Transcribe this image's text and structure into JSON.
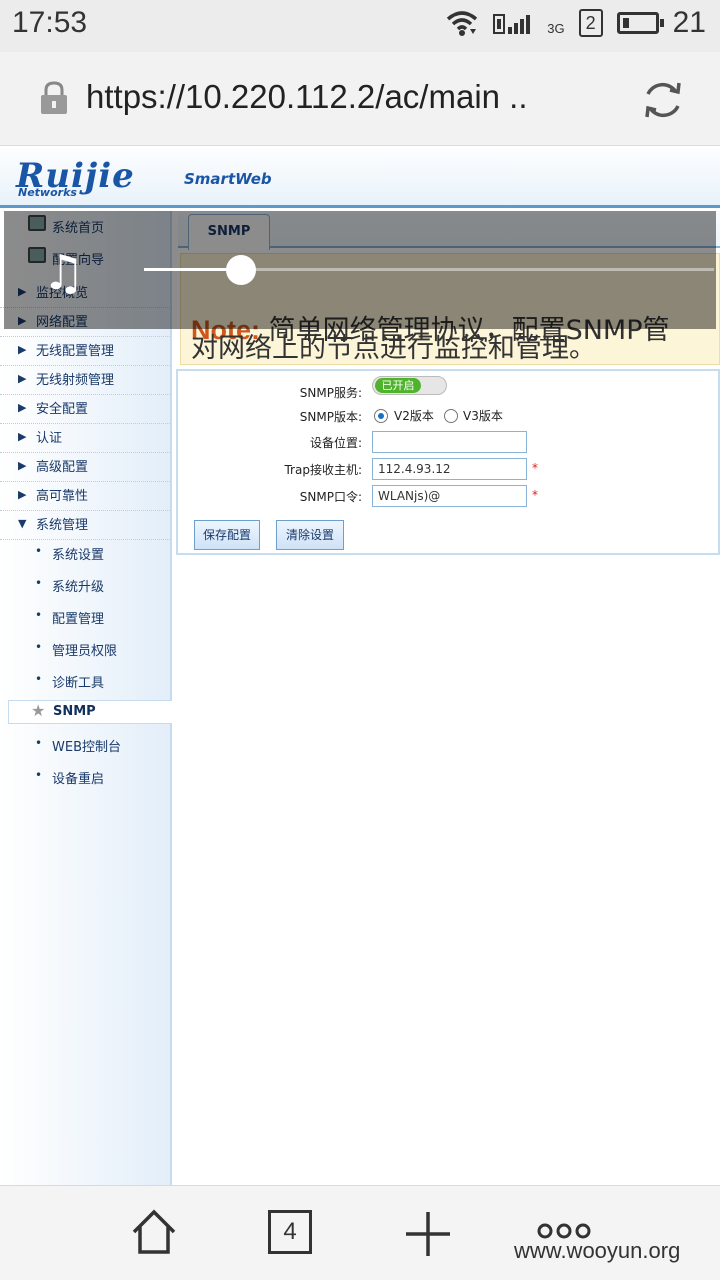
{
  "status_bar": {
    "time": "17:53",
    "network": "3G",
    "sim_slot": "2",
    "battery_percent": "21",
    "battery_level": 0.21
  },
  "browser": {
    "url": "https://10.220.112.2/ac/main ..",
    "tabs_count": "4",
    "watermark": "www.wooyun.org"
  },
  "header": {
    "logo": "Ruijie",
    "logo_sub": "Networks",
    "product": "SmartWeb"
  },
  "sidebar": {
    "top_items": [
      {
        "label": "系统首页"
      },
      {
        "label": "配置向导"
      }
    ],
    "groups": [
      {
        "label": "监控概览"
      },
      {
        "label": "网络配置"
      },
      {
        "label": "无线配置管理"
      },
      {
        "label": "无线射频管理"
      },
      {
        "label": "安全配置"
      },
      {
        "label": "认证"
      },
      {
        "label": "高级配置"
      },
      {
        "label": "高可靠性"
      },
      {
        "label": "系统管理"
      }
    ],
    "sub_items": [
      {
        "label": "系统设置"
      },
      {
        "label": "系统升级"
      },
      {
        "label": "配置管理"
      },
      {
        "label": "管理员权限"
      },
      {
        "label": "诊断工具"
      },
      {
        "label": "SNMP"
      },
      {
        "label": "WEB控制台"
      },
      {
        "label": "设备重启"
      }
    ]
  },
  "main": {
    "tab": "SNMP",
    "note_label": "Note:",
    "note_line1": "简单网络管理协议，配置SNMP管",
    "note_line2": "对网络上的节点进行监控和管理。",
    "form": {
      "service_label": "SNMP服务:",
      "service_state": "已开启",
      "version_label": "SNMP版本:",
      "version_v2": "V2版本",
      "version_v3": "V3版本",
      "location_label": "设备位置:",
      "location_value": "",
      "trap_label": "Trap接收主机:",
      "trap_value": "112.4.93.12",
      "community_label": "SNMP口令:",
      "community_value": "WLANjs)@",
      "required_mark": "*",
      "save_button": "保存配置",
      "clear_button": "清除设置"
    }
  },
  "media_overlay": {
    "progress": 0.17
  }
}
